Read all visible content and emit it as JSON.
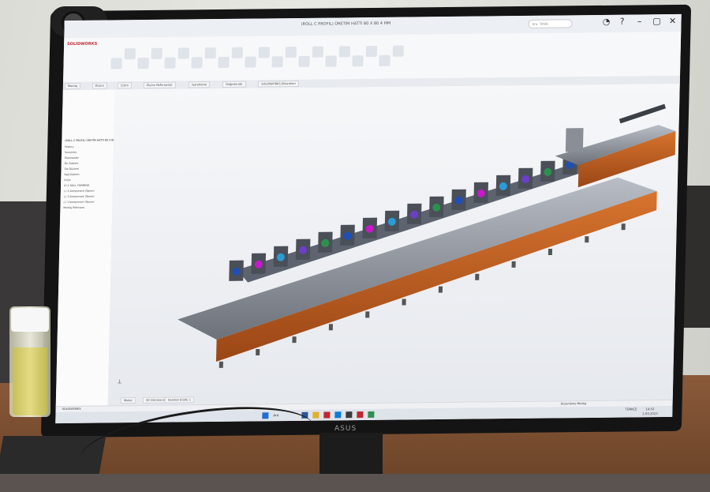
{
  "window": {
    "title": "(ROLL C PROFIL) ÜRETİM HATTI 80 X 80 4 MM",
    "search_placeholder": "Ara. TANG"
  },
  "app": {
    "logo": "SOLIDWORKS"
  },
  "tabs": [
    {
      "label": "Montaj"
    },
    {
      "label": "Düzen"
    },
    {
      "label": "Çizim"
    },
    {
      "label": "Ölçüm Referanslar"
    },
    {
      "label": "İşaretleme"
    },
    {
      "label": "Değerlendir"
    },
    {
      "label": "SOLIDWORKS Eklentileri"
    }
  ],
  "tree": {
    "root": "(ROLL C PROFIL) ÜRETİM HATTI 80 X 80 4 MM",
    "items": [
      "History",
      "Sensörler",
      "Ekipmanlar",
      "Ön Düzlem",
      "Üst Düzlem",
      "Sağ Düzlem",
      "Orijin",
      "(f) 1 ROLL FORMING",
      "(-) 1 Komponent (Tanım)",
      "(-) 1 Komponent (Tanım)",
      "(-) 1 Komponent (Tanım)",
      "Montaj Referansı"
    ]
  },
  "model_tabs": [
    "Model",
    "3D Görünümler",
    "Hareket Etüdü 1"
  ],
  "status": {
    "left": "SOLIDWORKS",
    "right": "Düzenleme Montaj"
  },
  "taskbar": {
    "search": "Ara",
    "time": "14:52",
    "date": "2.09.2023",
    "lang": "TÜRKÇE"
  },
  "monitor": {
    "brand": "ASUS"
  },
  "colors": {
    "machine_frame": "#c05a1e",
    "machine_steel": "#8c9199",
    "accent_blue": "#1f4fb5",
    "accent_magenta": "#c41ac9"
  }
}
